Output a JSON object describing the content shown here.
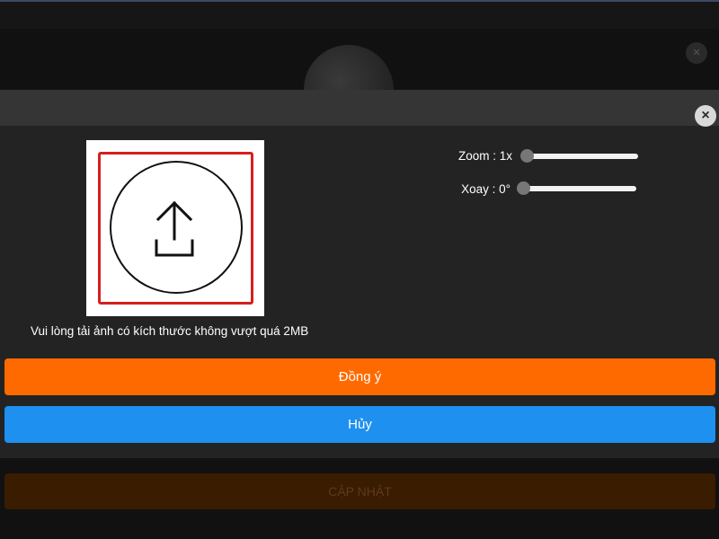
{
  "background": {
    "update_button_label": "CẬP NHẬT",
    "close_symbol": "×"
  },
  "modal": {
    "close_symbol": "×",
    "upload": {
      "icon": "upload-icon",
      "hint": "Vui lòng tải ảnh có kích thước không vượt quá 2MB"
    },
    "zoom": {
      "label": "Zoom : 1x",
      "value": 1
    },
    "rotate": {
      "label": "Xoay : 0°",
      "value": 0
    },
    "confirm_label": "Đồng ý",
    "cancel_label": "Hủy"
  },
  "colors": {
    "confirm": "#ff6a00",
    "cancel": "#1e90f0",
    "highlight": "#d61f1f"
  }
}
